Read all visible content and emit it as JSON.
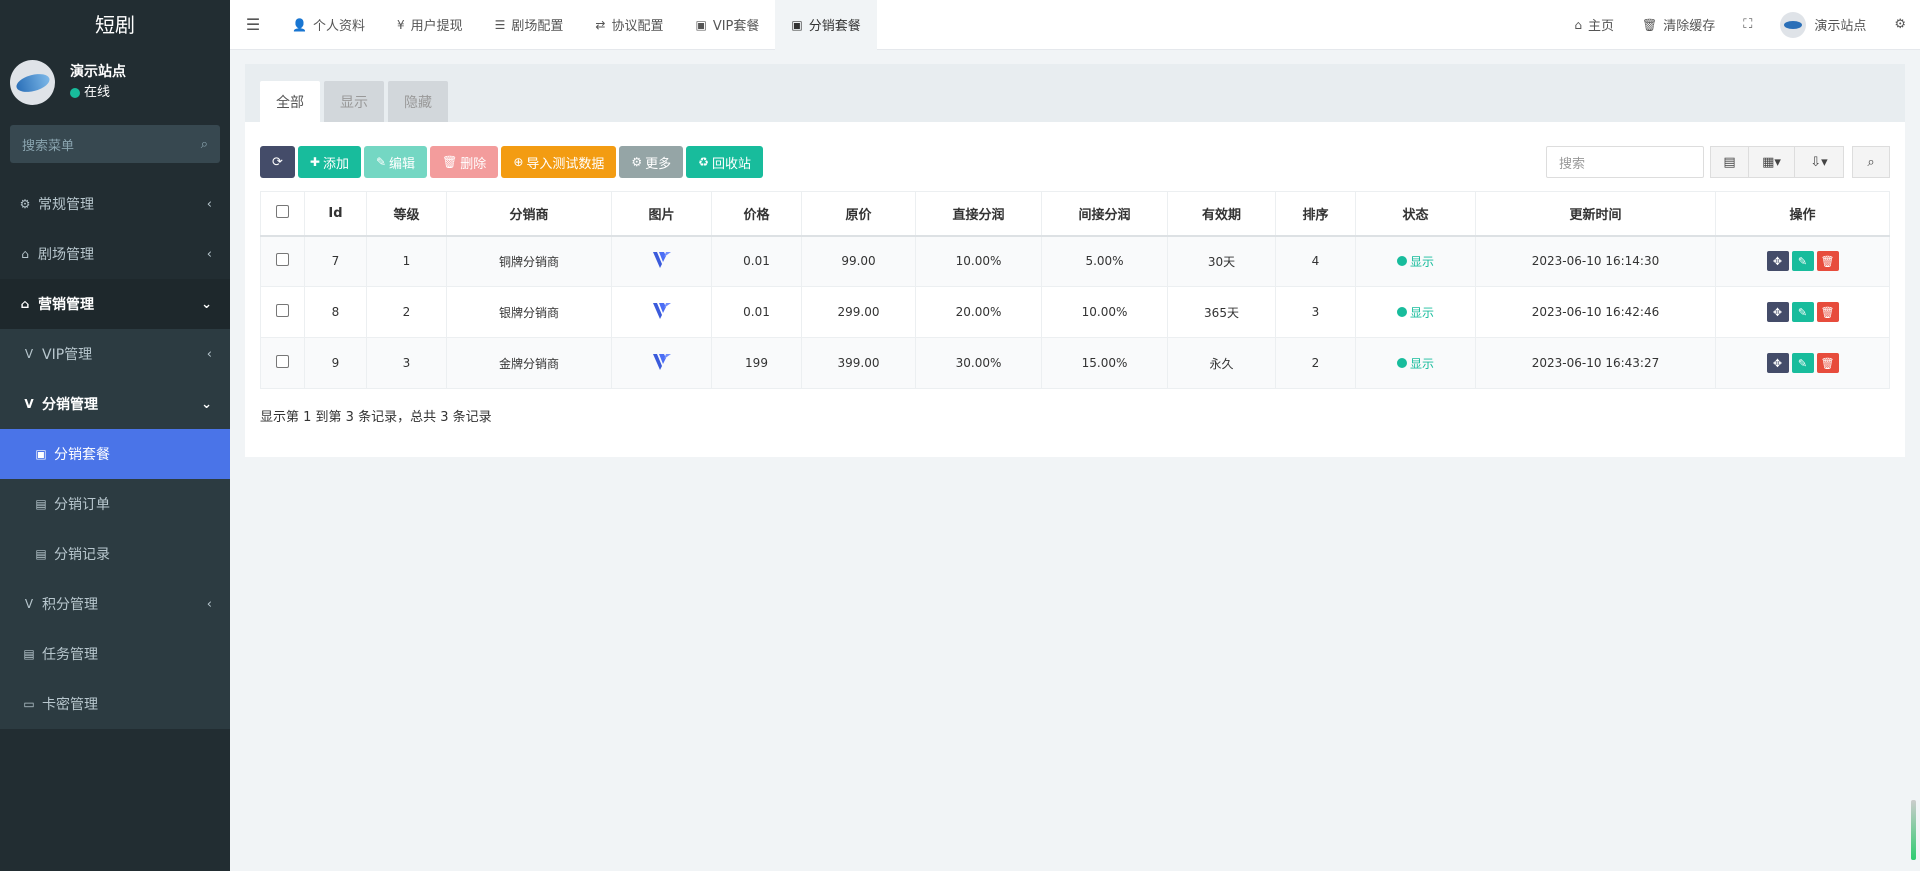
{
  "sidebar": {
    "logo": "短剧",
    "user": {
      "name": "演示站点",
      "status": "在线"
    },
    "search_placeholder": "搜索菜单",
    "items": [
      {
        "label": "常规管理",
        "icon": "cogs-icon",
        "glyph": "⚙",
        "arrow": "‹"
      },
      {
        "label": "剧场管理",
        "icon": "home-icon",
        "glyph": "⌂",
        "arrow": "‹"
      },
      {
        "label": "营销管理",
        "icon": "home-icon",
        "glyph": "⌂",
        "arrow": "⌄"
      },
      {
        "label": "VIP管理",
        "icon": "vimeo-icon",
        "glyph": "V",
        "arrow": "‹"
      },
      {
        "label": "分销管理",
        "icon": "vimeo-icon",
        "glyph": "V",
        "arrow": "⌄"
      },
      {
        "label": "分销套餐",
        "icon": "vimeo-square-icon",
        "glyph": "▣"
      },
      {
        "label": "分销订单",
        "icon": "file-icon",
        "glyph": "▤"
      },
      {
        "label": "分销记录",
        "icon": "file-icon",
        "glyph": "▤"
      },
      {
        "label": "积分管理",
        "icon": "vimeo-icon",
        "glyph": "V",
        "arrow": "‹"
      },
      {
        "label": "任务管理",
        "icon": "file-icon",
        "glyph": "▤"
      },
      {
        "label": "卡密管理",
        "icon": "money-icon",
        "glyph": "▭"
      }
    ]
  },
  "topbar": {
    "tabs": [
      {
        "label": "个人资料",
        "glyph": "👤"
      },
      {
        "label": "用户提现",
        "glyph": "¥"
      },
      {
        "label": "剧场配置",
        "glyph": "☰"
      },
      {
        "label": "协议配置",
        "glyph": "⇄"
      },
      {
        "label": "VIP套餐",
        "glyph": "▣"
      },
      {
        "label": "分销套餐",
        "glyph": "▣"
      }
    ],
    "right": {
      "home": "主页",
      "clear_cache": "清除缓存",
      "user": "演示站点"
    }
  },
  "panel": {
    "tabs": [
      "全部",
      "显示",
      "隐藏"
    ],
    "toolbar": {
      "add": "添加",
      "edit": "编辑",
      "delete": "删除",
      "import": "导入测试数据",
      "more": "更多",
      "recycle": "回收站"
    },
    "search_placeholder": "搜索"
  },
  "table": {
    "headers": [
      "Id",
      "等级",
      "分销商",
      "图片",
      "价格",
      "原价",
      "直接分润",
      "间接分润",
      "有效期",
      "排序",
      "状态",
      "更新时间",
      "操作"
    ],
    "rows": [
      {
        "id": "7",
        "level": "1",
        "name": "铜牌分销商",
        "price": "0.01",
        "orig": "99.00",
        "direct": "10.00%",
        "indirect": "5.00%",
        "valid": "30天",
        "sort": "4",
        "status": "显示",
        "time": "2023-06-10 16:14:30"
      },
      {
        "id": "8",
        "level": "2",
        "name": "银牌分销商",
        "price": "0.01",
        "orig": "299.00",
        "direct": "20.00%",
        "indirect": "10.00%",
        "valid": "365天",
        "sort": "3",
        "status": "显示",
        "time": "2023-06-10 16:42:46"
      },
      {
        "id": "9",
        "level": "3",
        "name": "金牌分销商",
        "price": "199",
        "orig": "399.00",
        "direct": "30.00%",
        "indirect": "15.00%",
        "valid": "永久",
        "sort": "2",
        "status": "显示",
        "time": "2023-06-10 16:43:27"
      }
    ]
  },
  "footer": "显示第 1 到第 3 条记录，总共 3 条记录",
  "colors": {
    "sidebar": "#222d32",
    "active": "#4a74e8",
    "success": "#18bc9c",
    "danger": "#e74c3c",
    "dark": "#444c69"
  }
}
